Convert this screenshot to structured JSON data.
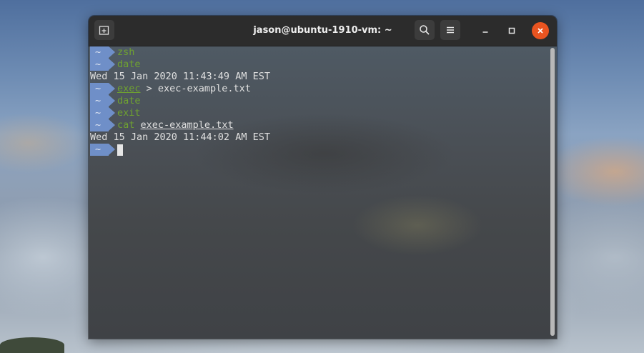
{
  "window": {
    "title": "jason@ubuntu-1910-vm: ~",
    "icons": {
      "new_tab": "new-tab-icon",
      "search": "search-icon",
      "menu": "hamburger-menu-icon",
      "minimize": "minimize-icon",
      "maximize": "maximize-icon",
      "close": "close-icon"
    },
    "close_color": "#e95420"
  },
  "terminal": {
    "prompt_symbol": "~",
    "prompt_color": "#6f8fc8",
    "command_color": "#6fa230",
    "lines": [
      {
        "cmd": "zsh"
      },
      {
        "cmd": "date"
      },
      {
        "output": "Wed 15 Jan 2020 11:43:49 AM EST"
      },
      {
        "cmd": "exec",
        "args": " > exec-example.txt"
      },
      {
        "cmd": "date"
      },
      {
        "cmd": "exit"
      },
      {
        "cmd": "cat",
        "args": "exec-example.txt"
      },
      {
        "output": "Wed 15 Jan 2020 11:44:02 AM EST"
      }
    ]
  }
}
